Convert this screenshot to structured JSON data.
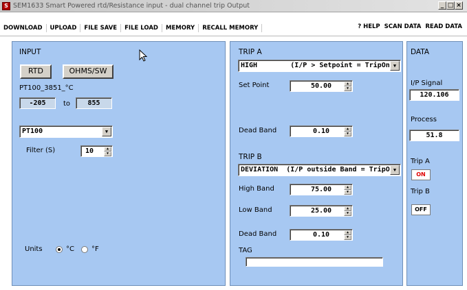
{
  "window": {
    "title": "SEM1633 Smart Powered rtd/Resistance input - dual channel trip Output",
    "icon": "S"
  },
  "menu": {
    "left": [
      "DOWNLOAD",
      "UPLOAD",
      "FILE SAVE",
      "FILE LOAD",
      "MEMORY",
      "RECALL MEMORY"
    ],
    "right": [
      "? HELP",
      "SCAN DATA",
      "READ DATA"
    ]
  },
  "input": {
    "heading": "INPUT",
    "rtd_button": "RTD",
    "ohms_button": "OHMS/SW",
    "sensor_label": "PT100_3851_°C",
    "range_low": "-205",
    "range_to": "to",
    "range_high": "855",
    "sensor_type": "PT100",
    "filter_label": "Filter (S)",
    "filter_value": "10",
    "units_label": "Units",
    "unit_c": "°C",
    "unit_f": "°F",
    "selected_unit": "C"
  },
  "trip": {
    "trip_a_heading": "TRIP A",
    "trip_a_mode": "HIGH        (I/P > Setpoint = TripOn)",
    "set_point_label": "Set Point",
    "set_point_value": "50.00",
    "dead_band_a_label": "Dead Band",
    "dead_band_a_value": "0.10",
    "trip_b_heading": "TRIP B",
    "trip_b_mode": "DEVIATION  (I/P outside Band = TripOn)",
    "high_band_label": "High Band",
    "high_band_value": "75.00",
    "low_band_label": "Low Band",
    "low_band_value": "25.00",
    "dead_band_b_label": "Dead Band",
    "dead_band_b_value": "0.10",
    "tag_label": "TAG",
    "tag_value": ""
  },
  "data": {
    "heading": "DATA",
    "ip_signal_label": "I/P Signal",
    "ip_signal_value": "120.106",
    "process_label": "Process",
    "process_value": "51.8",
    "trip_a_label": "Trip A",
    "trip_a_state": "ON",
    "trip_b_label": "Trip B",
    "trip_b_state": "OFF"
  },
  "colors": {
    "panel": "#a7c8f2",
    "on_text": "#e00000",
    "off_text": "#000000"
  }
}
